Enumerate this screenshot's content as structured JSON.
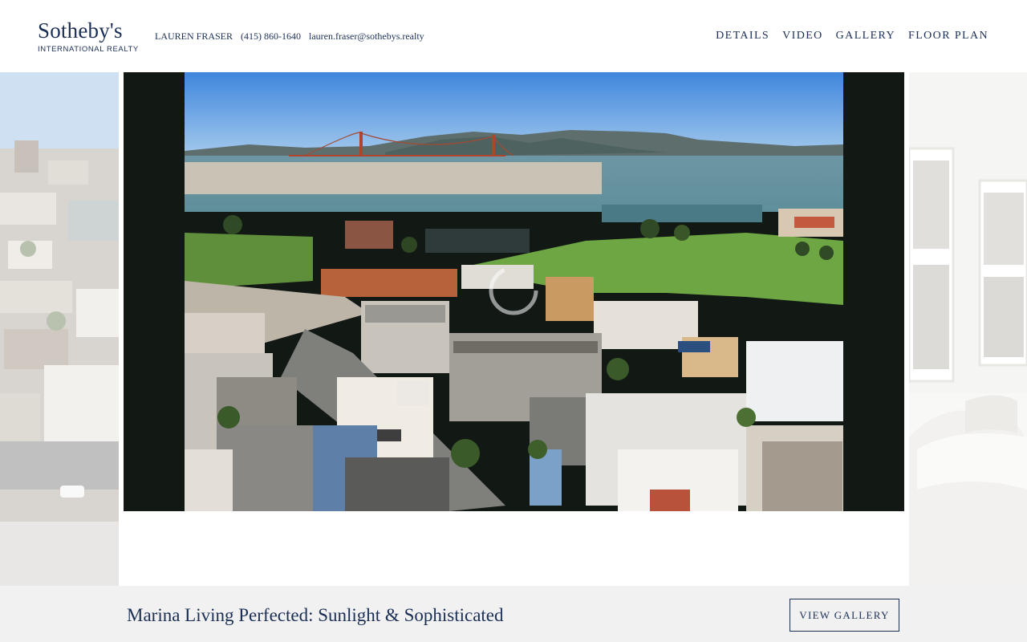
{
  "brand": {
    "name": "Sotheby's",
    "subtitle": "INTERNATIONAL REALTY"
  },
  "agent": {
    "name": "LAUREN FRASER",
    "phone": "(415) 860-1640",
    "email": "lauren.fraser@sothebys.realty"
  },
  "nav": {
    "items": [
      {
        "label": "DETAILS"
      },
      {
        "label": "VIDEO"
      },
      {
        "label": "GALLERY"
      },
      {
        "label": "FLOOR PLAN"
      }
    ]
  },
  "listing": {
    "title": "Marina Living Perfected: Sunlight & Sophisticated",
    "view_gallery_label": "VIEW GALLERY"
  },
  "colors": {
    "brand_navy": "#1b2f55",
    "frame_bg": "#121915",
    "bar_bg": "#f1f1f1"
  }
}
